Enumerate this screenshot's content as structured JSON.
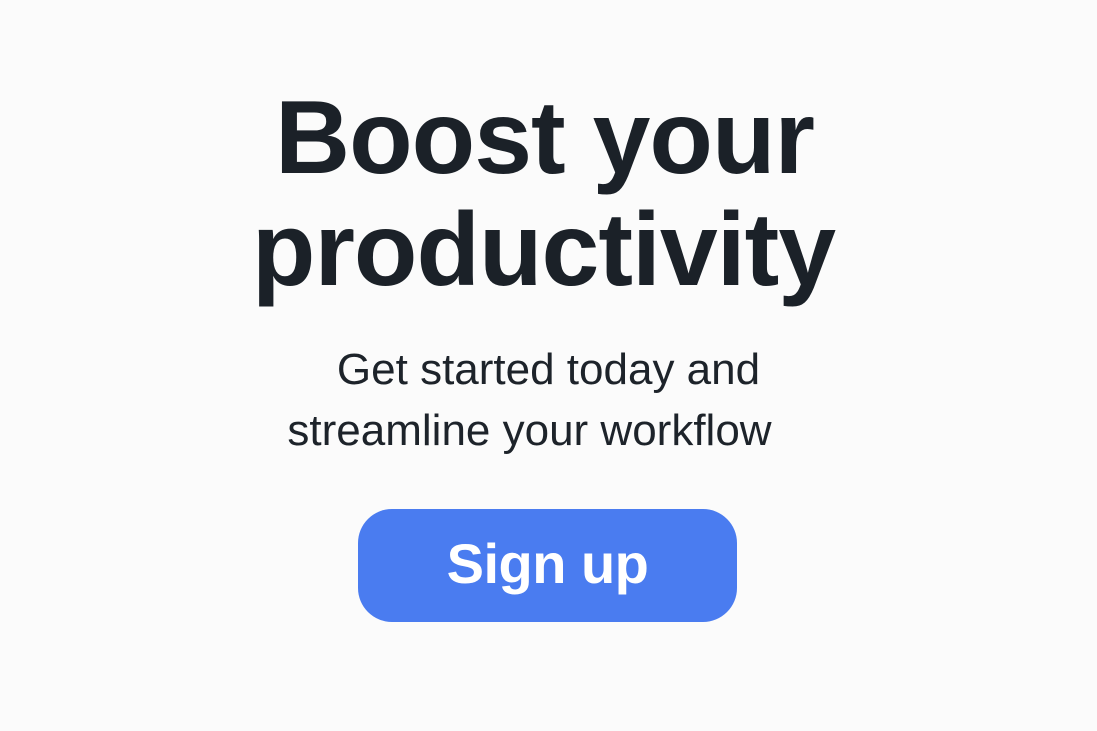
{
  "hero": {
    "headline_line1": "Boost your",
    "headline_line2": "productivity",
    "subtitle_line1": "Get started today and",
    "subtitle_line2": "streamline your workflow",
    "cta_label": "Sign up"
  },
  "colors": {
    "background": "#fbfbfb",
    "text": "#1b2128",
    "accent": "#4a7cf0",
    "button_text": "#ffffff"
  }
}
